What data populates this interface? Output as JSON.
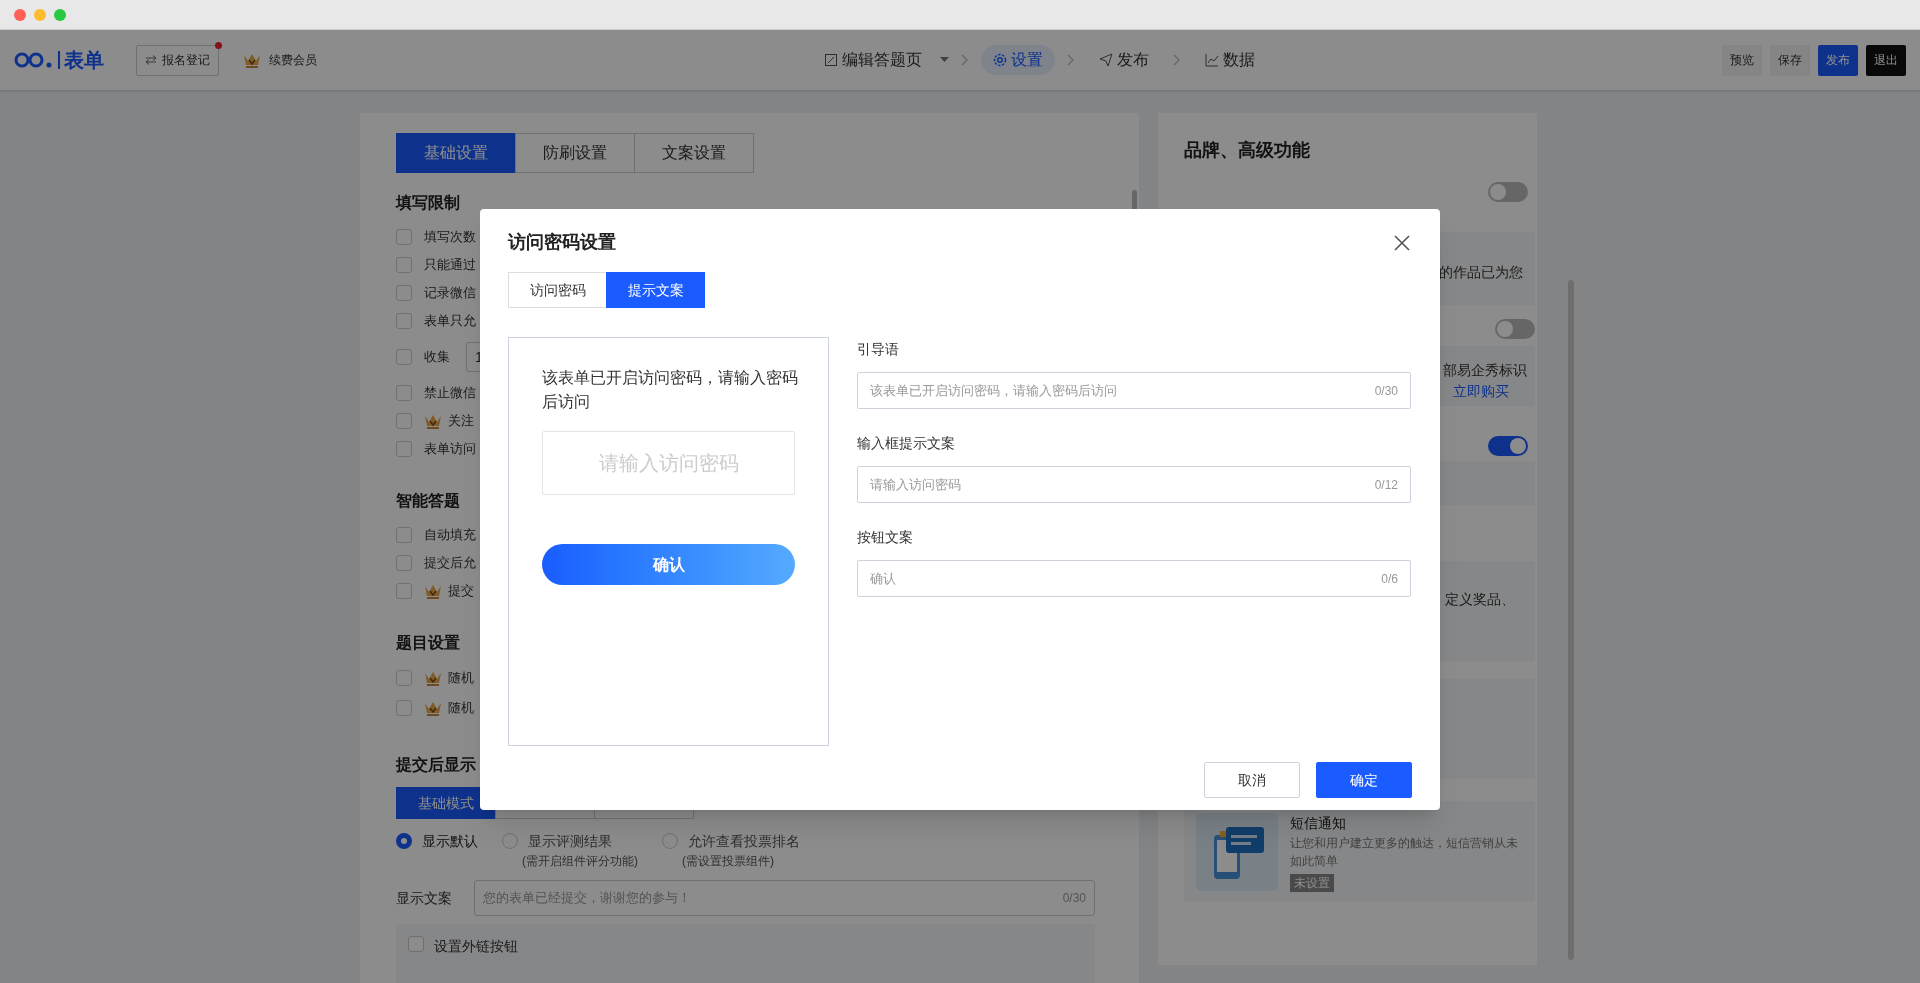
{
  "topbar": {
    "logo_text": "表单",
    "register_button": "报名登记",
    "register_badge": true,
    "member_label": "续费会员",
    "steps": [
      {
        "label": "编辑答题页",
        "dropdown": true,
        "selected": false
      },
      {
        "label": "设置",
        "dropdown": false,
        "selected": true
      },
      {
        "label": "发布",
        "dropdown": false,
        "selected": false
      },
      {
        "label": "数据",
        "dropdown": false,
        "selected": false
      }
    ],
    "actions": [
      {
        "label": "预览",
        "kind": "plain"
      },
      {
        "label": "保存",
        "kind": "plain"
      },
      {
        "label": "发布",
        "kind": "primary"
      },
      {
        "label": "退出",
        "kind": "dark"
      }
    ]
  },
  "settings": {
    "tabs": [
      {
        "label": "基础设置",
        "selected": true
      },
      {
        "label": "防刷设置",
        "selected": false
      },
      {
        "label": "文案设置",
        "selected": false
      }
    ],
    "sections": [
      {
        "title": "填写限制",
        "items": [
          {
            "label": "填写次数",
            "checked": false,
            "vip": false
          },
          {
            "label": "只能通过",
            "checked": false,
            "vip": false
          },
          {
            "label": "记录微信",
            "checked": false,
            "vip": false
          },
          {
            "label": "表单只允",
            "checked": false,
            "vip": false
          },
          {
            "label": "收集",
            "checked": false,
            "vip": false,
            "value": "1"
          },
          {
            "label": "禁止微信",
            "checked": false,
            "vip": false
          },
          {
            "label": "关注",
            "checked": false,
            "vip": true
          },
          {
            "label": "表单访问",
            "checked": false,
            "vip": false
          }
        ]
      },
      {
        "title": "智能答题",
        "items": [
          {
            "label": "自动填充",
            "checked": false,
            "vip": false
          },
          {
            "label": "提交后允",
            "checked": false,
            "vip": false
          },
          {
            "label": "提交",
            "checked": false,
            "vip": true
          }
        ]
      },
      {
        "title": "题目设置",
        "items": [
          {
            "label": "随机",
            "checked": false,
            "vip": true
          },
          {
            "label": "随机",
            "checked": false,
            "vip": true
          }
        ]
      }
    ],
    "after_submit": {
      "title": "提交后显示",
      "mode_tabs": [
        {
          "label": "基础模式",
          "selected": true
        },
        {
          "selected": false
        },
        {
          "selected": false
        }
      ],
      "options": [
        {
          "label": "显示默认",
          "selected": true
        },
        {
          "label": "显示评测结果",
          "note": "(需开启组件评分功能)",
          "selected": false
        },
        {
          "label": "允许查看投票排名",
          "note": "(需设置投票组件)",
          "selected": false
        }
      ],
      "text_label": "显示文案",
      "text_placeholder": "您的表单已经提交，谢谢您的参与！",
      "text_count": "0/30",
      "link_checkbox": {
        "label": "设置外链按钮",
        "checked": false
      }
    }
  },
  "features": {
    "title": "品牌、高级功能",
    "cards": [
      {
        "kind": "text",
        "lines": [
          "的作品已为您"
        ],
        "toggle": false
      },
      {
        "kind": "text",
        "lines": [
          "部易企秀标识"
        ],
        "link": "立即购买",
        "toggle": false
      },
      {
        "kind": "empty",
        "toggle": true
      },
      {
        "kind": "text",
        "lines": [
          "定义奖品、"
        ]
      },
      {
        "kind": "empty"
      },
      {
        "kind": "promo",
        "title": "短信通知",
        "desc": "让您和用户建立更多的触达，短信营销从未如此简单",
        "badge": "未设置"
      }
    ]
  },
  "dialog": {
    "title": "访问密码设置",
    "tabs": [
      {
        "label": "访问密码",
        "selected": false
      },
      {
        "label": "提示文案",
        "selected": true
      }
    ],
    "preview": {
      "message": "该表单已开启访问密码，请输入密码后访问",
      "input_placeholder": "请输入访问密码",
      "button": "确认"
    },
    "fields": [
      {
        "label": "引导语",
        "placeholder": "该表单已开启访问密码，请输入密码后访问",
        "count": "0/30"
      },
      {
        "label": "输入框提示文案",
        "placeholder": "请输入访问密码",
        "count": "0/12"
      },
      {
        "label": "按钮文案",
        "placeholder": "确认",
        "count": "0/6"
      }
    ],
    "buttons": [
      {
        "label": "取消",
        "kind": "secondary"
      },
      {
        "label": "确定",
        "kind": "primary"
      }
    ]
  }
}
